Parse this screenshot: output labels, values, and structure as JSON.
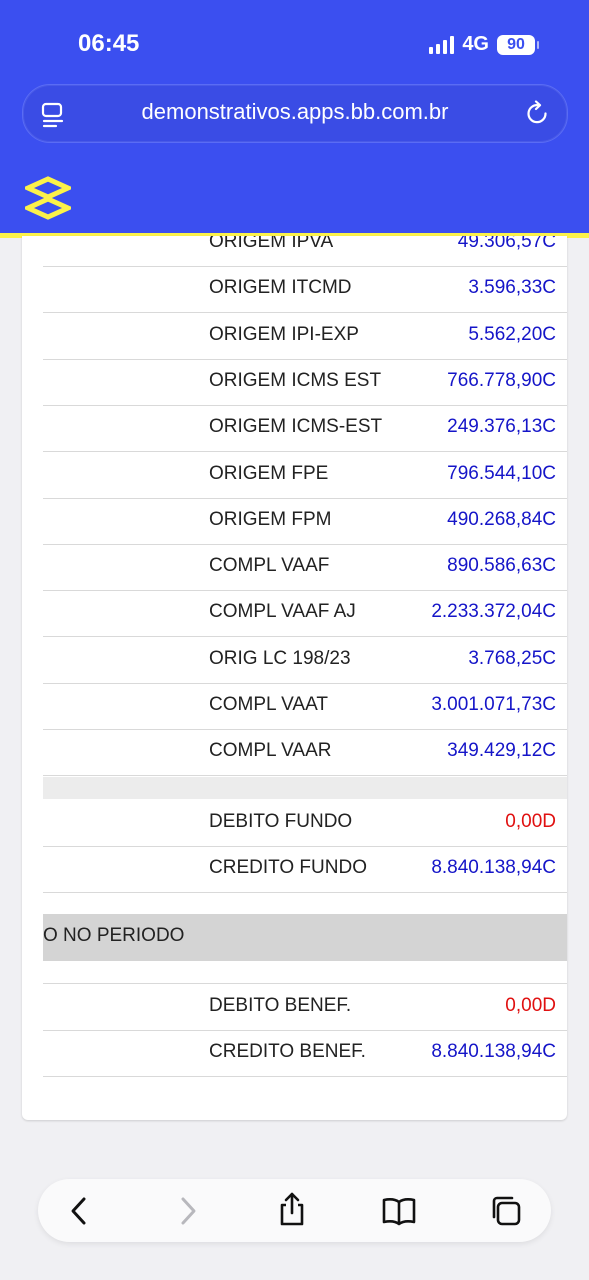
{
  "status": {
    "time": "06:45",
    "network": "4G",
    "battery": "90"
  },
  "browser": {
    "url": "demonstrativos.apps.bb.com.br"
  },
  "rows": [
    {
      "label": "ORIGEM IPVA",
      "value": "49.306,57C",
      "color": "#1515c8"
    },
    {
      "label": "ORIGEM ITCMD",
      "value": "3.596,33C",
      "color": "#1515c8"
    },
    {
      "label": "ORIGEM IPI-EXP",
      "value": "5.562,20C",
      "color": "#1515c8"
    },
    {
      "label": "ORIGEM ICMS EST",
      "value": "766.778,90C",
      "color": "#1515c8"
    },
    {
      "label": "ORIGEM ICMS-EST",
      "value": "249.376,13C",
      "color": "#1515c8"
    },
    {
      "label": "ORIGEM FPE",
      "value": "796.544,10C",
      "color": "#1515c8"
    },
    {
      "label": "ORIGEM FPM",
      "value": "490.268,84C",
      "color": "#1515c8"
    },
    {
      "label": "COMPL VAAF",
      "value": "890.586,63C",
      "color": "#1515c8"
    },
    {
      "label": "COMPL VAAF AJ",
      "value": "2.233.372,04C",
      "color": "#1515c8"
    },
    {
      "label": "ORIG LC 198/23",
      "value": "3.768,25C",
      "color": "#1515c8"
    },
    {
      "label": "COMPL VAAT",
      "value": "3.001.071,73C",
      "color": "#1515c8"
    },
    {
      "label": "COMPL VAAR",
      "value": "349.429,12C",
      "color": "#1515c8"
    }
  ],
  "fund_rows": [
    {
      "label": "DEBITO FUNDO",
      "value": "0,00D",
      "color": "#e01010"
    },
    {
      "label": "CREDITO FUNDO",
      "value": "8.840.138,94C",
      "color": "#1515c8"
    }
  ],
  "section": {
    "title": "O NO PERIODO"
  },
  "benef_rows": [
    {
      "label": "DEBITO BENEF.",
      "value": "0,00D",
      "color": "#e01010"
    },
    {
      "label": "CREDITO BENEF.",
      "value": "8.840.138,94C",
      "color": "#1515c8"
    }
  ],
  "toolbar": {
    "icons": [
      "back-icon",
      "forward-icon",
      "share-icon",
      "bookmarks-icon",
      "tabs-icon"
    ]
  }
}
